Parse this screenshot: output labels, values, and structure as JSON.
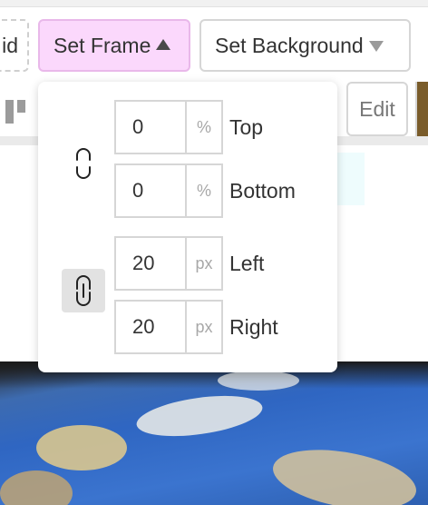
{
  "toolbar": {
    "grid_label": "id",
    "frame_label": "Set Frame",
    "background_label": "Set Background",
    "edit_label": "Edit"
  },
  "frame_panel": {
    "vertical": {
      "linked": false,
      "top": {
        "value": "0",
        "unit": "%",
        "label": "Top"
      },
      "bottom": {
        "value": "0",
        "unit": "%",
        "label": "Bottom"
      }
    },
    "horizontal": {
      "linked": true,
      "left": {
        "value": "20",
        "unit": "px",
        "label": "Left"
      },
      "right": {
        "value": "20",
        "unit": "px",
        "label": "Right"
      }
    }
  },
  "colors": {
    "frame_button_bg": "#fbd8fc",
    "frame_button_border": "#e9b8ea",
    "link_active_bg": "#e2e2e2"
  },
  "icons": {
    "frame_caret": "caret-up-icon",
    "background_caret": "caret-down-icon",
    "vertical_link": "unlinked-icon",
    "horizontal_link": "link-icon",
    "align": "align-icon"
  }
}
